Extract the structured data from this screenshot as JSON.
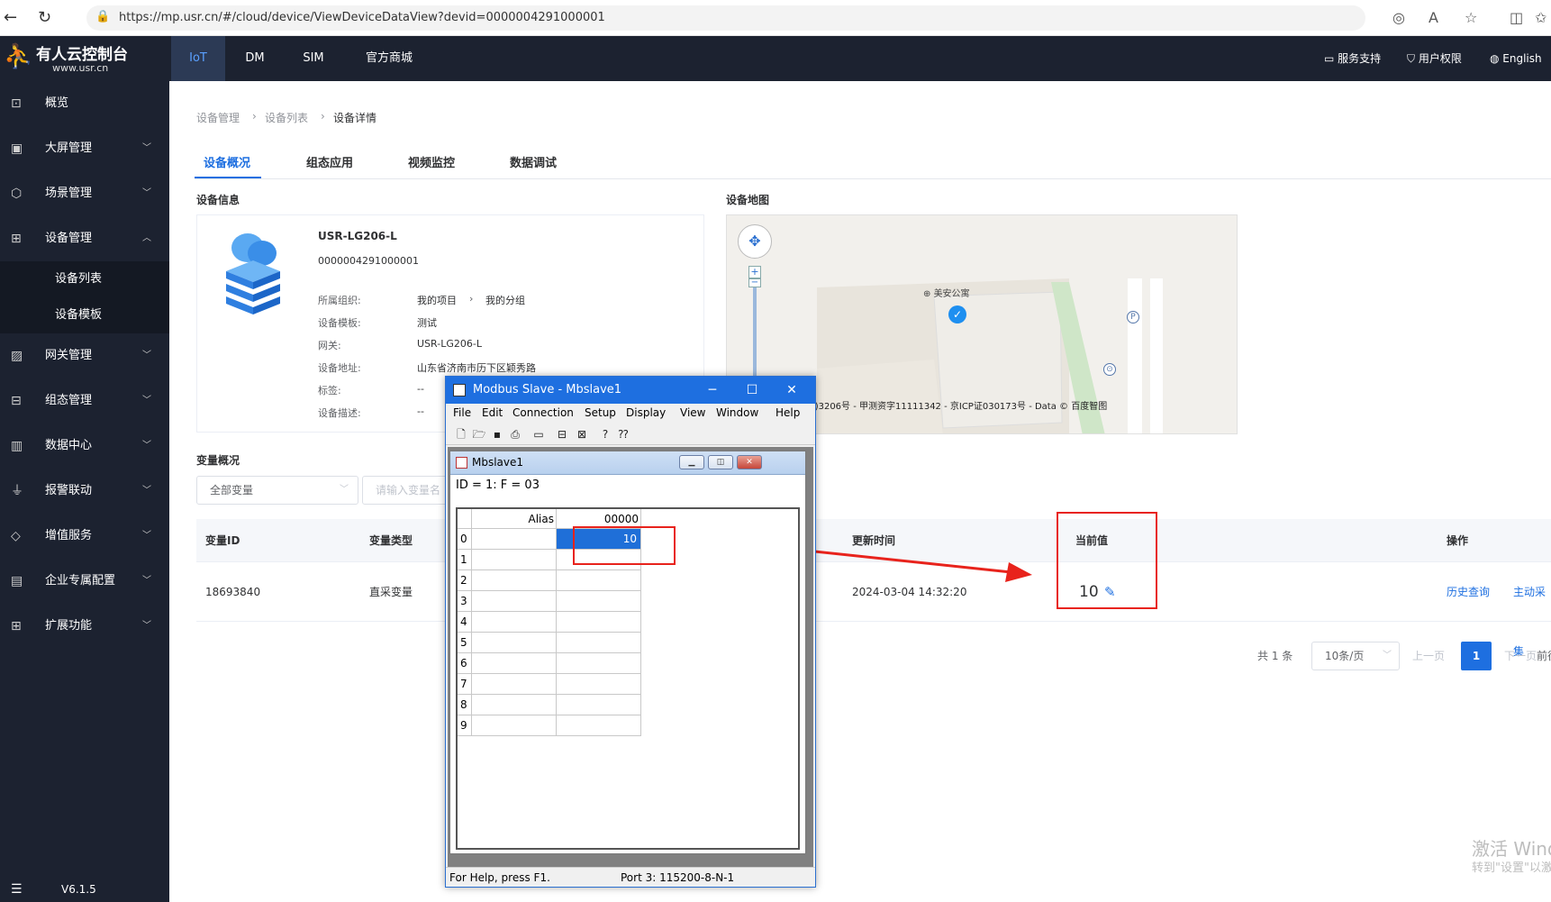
{
  "browser": {
    "url": "https://mp.usr.cn/#/cloud/device/ViewDeviceDataView?devid=0000004291000001"
  },
  "brand": {
    "name": "有人云控制台",
    "site": "www.usr.cn"
  },
  "topnav": {
    "items": [
      "IoT",
      "DM",
      "SIM",
      "官方商城"
    ],
    "right": [
      "服务支持",
      "用户权限",
      "English"
    ]
  },
  "sidebar": {
    "items": [
      "概览",
      "大屏管理",
      "场景管理",
      "设备管理",
      "网关管理",
      "组态管理",
      "数据中心",
      "报警联动",
      "增值服务",
      "企业专属配置",
      "扩展功能"
    ],
    "sub": [
      "设备列表",
      "设备模板"
    ],
    "version": "V6.1.5"
  },
  "breadcrumb": [
    "设备管理",
    "设备列表",
    "设备详情"
  ],
  "tabs": [
    "设备概况",
    "组态应用",
    "视频监控",
    "数据调试"
  ],
  "device_info": {
    "section": "设备信息",
    "name": "USR-LG206-L",
    "id": "0000004291000001",
    "fields": [
      {
        "k": "所属组织:",
        "v": "我的项目",
        "v2": "我的分组"
      },
      {
        "k": "设备模板:",
        "v": "测试"
      },
      {
        "k": "网关:",
        "v": "USR-LG206-L"
      },
      {
        "k": "设备地址:",
        "v": "山东省济南市历下区颖秀路"
      },
      {
        "k": "标签:",
        "v": "--"
      },
      {
        "k": "设备描述:",
        "v": "--"
      }
    ]
  },
  "device_map": {
    "section": "设备地图",
    "poi": "美安公寓",
    "copyright": "S(2023)3206号 - 甲测资字11111342 - 京ICP证030173号 - Data © 百度智图"
  },
  "variables": {
    "section": "变量概况",
    "filter_select": "全部变量",
    "search_placeholder": "请输入变量名",
    "headers": {
      "id": "变量ID",
      "type": "变量类型",
      "time": "更新时间",
      "value": "当前值",
      "ops": "操作"
    },
    "row": {
      "id": "18693840",
      "type": "直采变量",
      "time": "2024-03-04 14:32:20",
      "value": "10",
      "op1": "历史查询",
      "op2": "主动采集"
    }
  },
  "pagination": {
    "total": "共 1 条",
    "size": "10条/页",
    "prev": "上一页",
    "current": "1",
    "next": "下一页",
    "goto": "前往"
  },
  "watermark": {
    "line1": "激活 Windo",
    "line2": "转到\"设置\"以激活"
  },
  "modbus": {
    "title": "Modbus Slave - Mbslave1",
    "menu": [
      "File",
      "Edit",
      "Connection",
      "Setup",
      "Display",
      "View",
      "Window",
      "Help"
    ],
    "child_title": "Mbslave1",
    "id_line": "ID = 1: F = 03",
    "grid_headers": {
      "alias": "Alias",
      "col": "00000"
    },
    "rows": [
      "0",
      "1",
      "2",
      "3",
      "4",
      "5",
      "6",
      "7",
      "8",
      "9"
    ],
    "value0": "10",
    "status_left": "For Help, press F1.",
    "status_right": "Port 3: 115200-8-N-1"
  }
}
